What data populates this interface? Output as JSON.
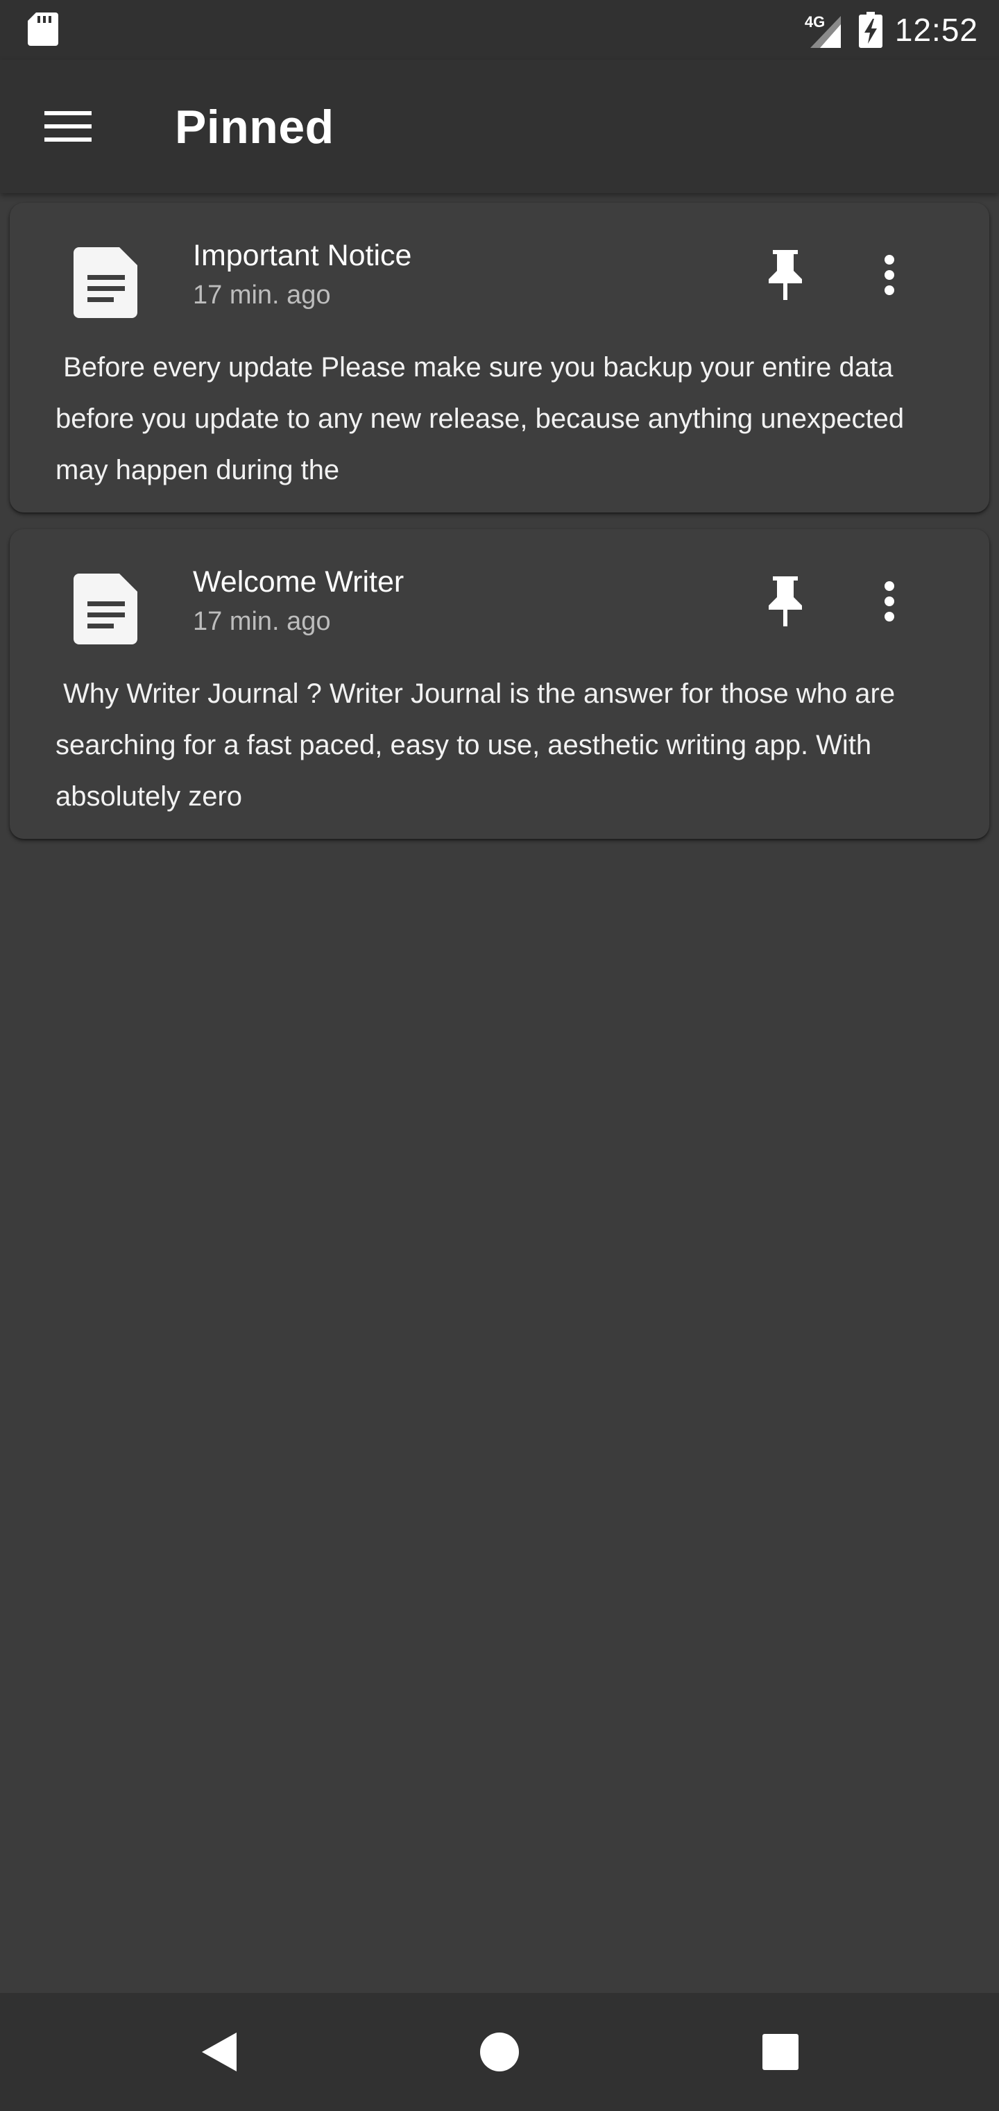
{
  "status_bar": {
    "network_type": "4G",
    "time": "12:52",
    "icons": [
      "sd-card-icon",
      "signal-icon",
      "battery-charging-icon"
    ]
  },
  "app_bar": {
    "menu_icon": "menu-icon",
    "title": "Pinned"
  },
  "notes": [
    {
      "title": "Important Notice",
      "time": "17 min. ago",
      "preview": " Before every update Please make sure you backup your entire data\nbefore you update to any new release, because anything unexpected\nmay happen during the",
      "icons": [
        "document-icon",
        "pin-icon",
        "more-vert-icon"
      ]
    },
    {
      "title": "Welcome Writer",
      "time": "17 min. ago",
      "preview": " Why Writer Journal ? Writer Journal is the answer for those who are\nsearching for a fast paced, easy to use, aesthetic writing app. With\nabsolutely zero",
      "icons": [
        "document-icon",
        "pin-icon",
        "more-vert-icon"
      ]
    }
  ],
  "nav_bar": {
    "icons": [
      "back-icon",
      "home-icon",
      "recents-icon"
    ]
  },
  "colors": {
    "background": "#3c3c3c",
    "app_bar": "#323232",
    "card": "#3e3e3e",
    "text_primary": "#ffffff",
    "text_secondary": "#bdbdbd"
  }
}
